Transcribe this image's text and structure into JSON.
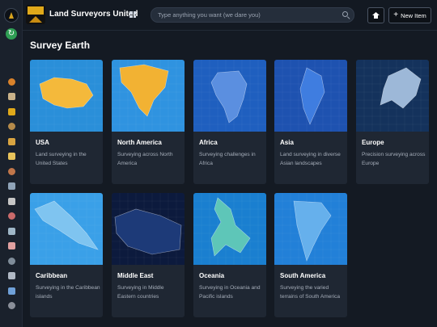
{
  "brand": {
    "name": "Land Surveyors United"
  },
  "search": {
    "placeholder": "Type anything you want (we dare you)"
  },
  "header": {
    "new_item_label": "New Item"
  },
  "page": {
    "title": "Survey Earth"
  },
  "sidebar": {
    "icon_colors": [
      "#d9822b",
      "#c9b28a",
      "#e0a91a",
      "#b58a4a",
      "#d9a441",
      "#e8c35b",
      "#c0764a",
      "#8fa3b8",
      "#c6c6c6",
      "#c96a6a",
      "#9fb7c7",
      "#e0a0a0",
      "#7f8c99",
      "#b0b8c4",
      "#6fa0d8",
      "#8a8f99"
    ]
  },
  "cards": [
    {
      "title": "USA",
      "description": "Land surveying in the United States",
      "bg": "#2a8fd9",
      "land": "#f4b93b"
    },
    {
      "title": "North America",
      "description": "Surveying across North America",
      "bg": "#2f93e0",
      "land": "#f2b233"
    },
    {
      "title": "Africa",
      "description": "Surveying challenges in Africa",
      "bg": "#1f5fbf",
      "land": "#5b8fe0"
    },
    {
      "title": "Asia",
      "description": "Land surveying in diverse Asian landscapes",
      "bg": "#1e52b0",
      "land": "#3f7de0"
    },
    {
      "title": "Europe",
      "description": "Precision surveying across Europe",
      "bg": "#14325c",
      "land": "#9db8d8"
    },
    {
      "title": "Caribbean",
      "description": "Surveying in the Caribbean islands",
      "bg": "#3aa0e8",
      "land": "#7fc4f0"
    },
    {
      "title": "Middle East",
      "description": "Surveying in Middle Eastern countries",
      "bg": "#0c1a3d",
      "land": "#1d3a78"
    },
    {
      "title": "Oceania",
      "description": "Surveying in Oceania and Pacific islands",
      "bg": "#1a7fd0",
      "land": "#5ec6b8"
    },
    {
      "title": "South America",
      "description": "Surveying the varied terrains of South America",
      "bg": "#2280d8",
      "land": "#66b0ec"
    }
  ]
}
